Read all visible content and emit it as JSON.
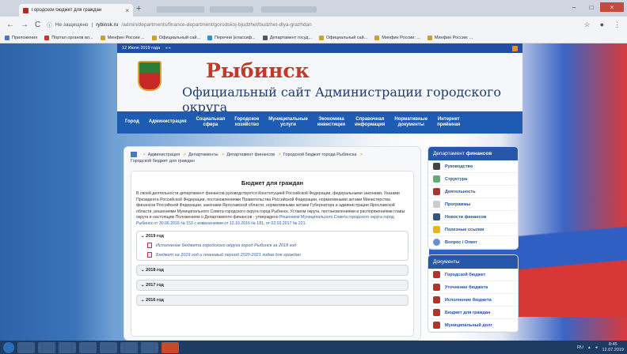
{
  "browser": {
    "tab_title": "Городской бюджет для граждан",
    "tab_close": "×",
    "new_tab": "+",
    "window_buttons": [
      "–",
      "□",
      "×"
    ],
    "nav": [
      "←",
      "→",
      "C"
    ],
    "security": "Не защищено",
    "host": "rybinsk.ru",
    "path": "/admin/departments/finance-department/gorodskoj-bjudzhet/budzhet-dlya-grazhdan",
    "right_icons": [
      "☆",
      "●",
      "⋮"
    ]
  },
  "bookmarks": [
    "Приложения",
    "Портал органов вл...",
    "Минфин России ...",
    "Официальный сай...",
    "Перечни (классиф...",
    "Департамент госуд...",
    "Официальный сай...",
    "Минфин России: ...",
    "Минфин России: ..."
  ],
  "site": {
    "date": "12 Июля 2019 года",
    "title": "Рыбинск",
    "subtitle": "Официальный сайт Администрации городского округа",
    "menu": [
      "Город",
      "Администрация",
      "Социальная\nсфера",
      "Городское\nхозяйство",
      "Муниципальные\nуслуги",
      "Экономика\nинвестиции",
      "Справочная\nинформация",
      "Нормативные\nдокументы",
      "Интернет\nприёмная"
    ],
    "breadcrumbs": [
      "Администрация",
      "Департаменты",
      "Департамент финансов",
      "Городской бюджет города Рыбинска"
    ],
    "breadcrumb_current": "Городской бюджет для граждан",
    "heading": "Бюджет для граждан",
    "body_text": "В своей деятельности департамент финансов руководствуется Конституцией Российской Федерации, федеральными законами, Указами Президента Российской Федерации, постановлениями Правительства Российской Федерации, нормативными актами Министерства финансов Российской Федерации, законами Ярославской области, нормативными актами Губернатора и администрации Ярославской области, решениями Муниципального Совета городского округа город Рыбинск, Уставом округа, постановлениями и распоряжениями главы округа и настоящим Положением о Департаменте финансов - утверждено",
    "body_link": "Решением Муниципального Совета городского округа город Рыбинск от 30.06.2016 № 153 с изменениями от 12.10.2016 № 181, от 02.03.2017 № 221.",
    "accordion": [
      {
        "label": "2019 год",
        "open": true,
        "docs": [
          "Исполнение бюджета городского округа город Рыбинск за 2018 год",
          "Бюджет на 2019 год и плановый период 2020-2021 годов для граждан"
        ]
      },
      {
        "label": "2018 год",
        "open": false,
        "docs": []
      },
      {
        "label": "2017 год",
        "open": false,
        "docs": []
      },
      {
        "label": "2016 год",
        "open": false,
        "docs": []
      }
    ],
    "sidebar1": {
      "head_prefix": "Департамент",
      "head_bold": "финансов",
      "items": [
        "Руководство",
        "Структура",
        "Деятельность",
        "Программы",
        "Новости финансов",
        "Полезные ссылки",
        "Вопрос / Ответ"
      ]
    },
    "sidebar2": {
      "head": "Документы",
      "items": [
        "Городской бюджет",
        "Уточнение бюджета",
        "Исполнение бюджета",
        "Бюджет для граждан",
        "Муниципальный долг"
      ]
    }
  },
  "taskbar": {
    "lang": "RU",
    "time": "8:45",
    "date": "12.07.2019"
  }
}
